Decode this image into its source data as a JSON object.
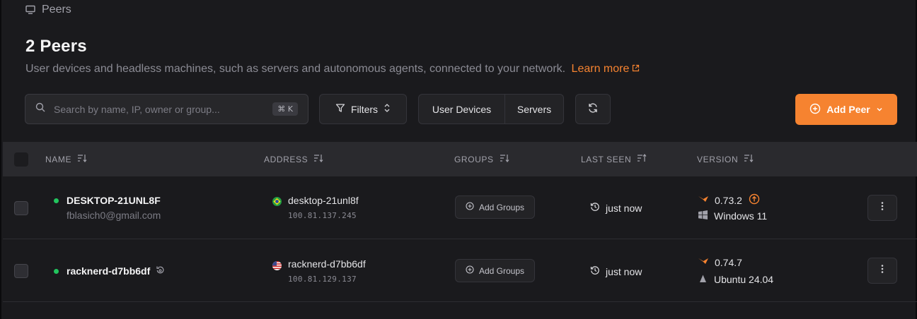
{
  "breadcrumb": {
    "label": "Peers",
    "icon": "monitor-icon"
  },
  "header": {
    "title": "2 Peers",
    "subtitle": "User devices and headless machines, such as servers and autonomous agents, connected to your network.",
    "learn_more": "Learn more"
  },
  "toolbar": {
    "search_placeholder": "Search by name, IP, owner or group...",
    "shortcut": "⌘ K",
    "filters_label": "Filters",
    "segment_user_devices": "User Devices",
    "segment_servers": "Servers",
    "add_peer_label": "Add Peer"
  },
  "table": {
    "columns": [
      "NAME",
      "ADDRESS",
      "GROUPS",
      "LAST SEEN",
      "VERSION"
    ],
    "rows": [
      {
        "name": "DESKTOP-21UNL8F",
        "email": "fblasich0@gmail.com",
        "status": "online",
        "flag": "BR",
        "hostname": "desktop-21unl8f",
        "ip": "100.81.137.245",
        "groups_button": "Add Groups",
        "last_seen": "just now",
        "version": "0.73.2",
        "update_available": true,
        "os": "Windows 11",
        "os_icon": "windows-icon"
      },
      {
        "name": "racknerd-d7bb6df",
        "email": "",
        "status": "online",
        "flag": "US",
        "hostname": "racknerd-d7bb6df",
        "ip": "100.81.129.137",
        "groups_button": "Add Groups",
        "last_seen": "just now",
        "version": "0.74.7",
        "update_available": false,
        "os": "Ubuntu 24.04",
        "os_icon": "linux-icon"
      }
    ]
  },
  "colors": {
    "accent": "#f68330",
    "online": "#22c55e",
    "background": "#1a1a1d"
  }
}
